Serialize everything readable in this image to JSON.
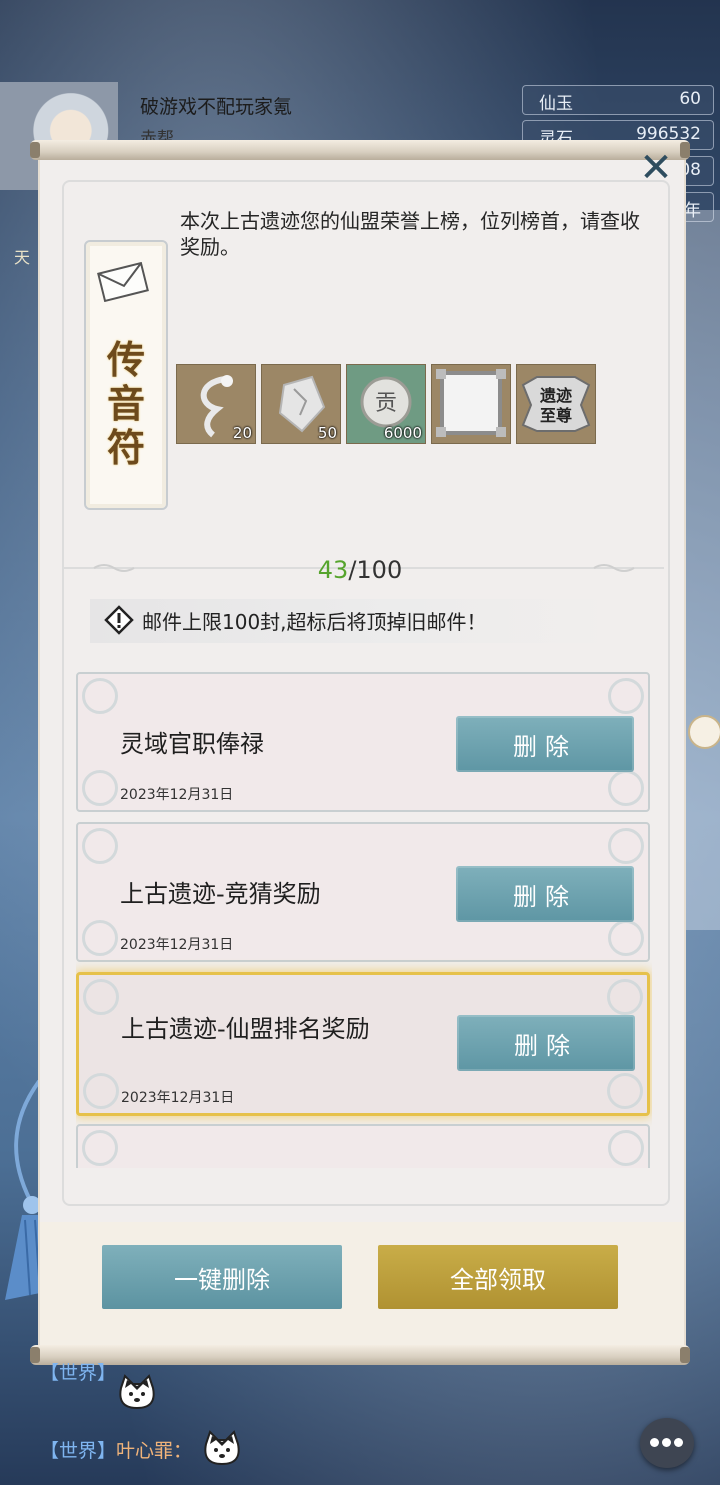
{
  "player": {
    "name": "破游戏不配玩家氪",
    "subtitle": "赤帮"
  },
  "resources": [
    {
      "label": "仙玉",
      "value": "60"
    },
    {
      "label": "灵石",
      "value": "996532"
    },
    {
      "label": "",
      "value": "08"
    },
    {
      "label": "",
      "value": "年"
    }
  ],
  "left_side": {
    "label": "天"
  },
  "letter": {
    "talisman_title": "传音符",
    "message": "本次上古遗迹您的仙盟荣誉上榜，位列榜首，请查收奖励。",
    "rewards": [
      {
        "icon": "dragon-feather-icon",
        "count": "20"
      },
      {
        "icon": "crystal-shard-icon",
        "count": "50"
      },
      {
        "icon": "contribution-coin-icon",
        "count": "6000",
        "coin_text": "贡"
      },
      {
        "icon": "avatar-frame-icon",
        "count": ""
      },
      {
        "icon": "title-badge-icon",
        "count": "",
        "badge_text": "遗迹至尊"
      }
    ]
  },
  "mailbox": {
    "current": "43",
    "separator": "/",
    "max": "100",
    "warning": "邮件上限100封,超标后将顶掉旧邮件！"
  },
  "mails": [
    {
      "title": "灵域官职俸禄",
      "date": "2023年12月31日",
      "action": "删除",
      "selected": false
    },
    {
      "title": "上古遗迹-竞猜奖励",
      "date": "2023年12月31日",
      "action": "删除",
      "selected": false
    },
    {
      "title": "上古遗迹-仙盟排名奖励",
      "date": "2023年12月31日",
      "action": "删除",
      "selected": true
    }
  ],
  "footer": {
    "delete_all": "一键删除",
    "claim_all": "全部领取"
  },
  "chat": [
    {
      "channel": "【世界】",
      "name": ""
    },
    {
      "channel": "【世界】",
      "name": "叶心罪："
    }
  ],
  "colors": {
    "accent_teal": "#6aa3b0",
    "accent_gold": "#bfa03c",
    "count_green": "#56a42d",
    "selected_border": "#e6c14a"
  }
}
